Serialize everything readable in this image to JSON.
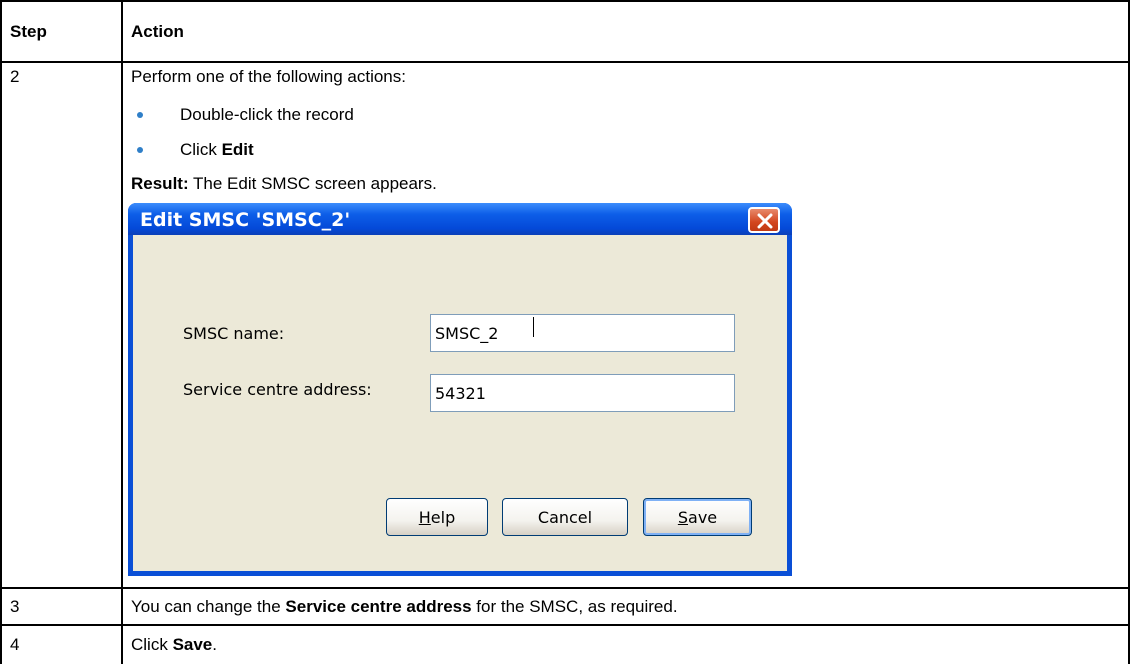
{
  "table": {
    "headers": [
      "Step",
      "Action"
    ],
    "rows": [
      {
        "step": "2",
        "intro": "Perform one of the following actions:",
        "bullets": [
          {
            "text": "Double-click the record",
            "bold": ""
          },
          {
            "text": "Click ",
            "bold": "Edit"
          }
        ],
        "result_label": "Result:",
        "result_text": " The Edit SMSC screen appears."
      },
      {
        "step": "3",
        "pre": "You can change the ",
        "bold": "Service centre address",
        "post": " for the SMSC, as required."
      },
      {
        "step": "4",
        "pre": "Click ",
        "bold": "Save",
        "post": "."
      }
    ]
  },
  "dialog": {
    "title": "Edit SMSC 'SMSC_2'",
    "fields": [
      {
        "label": "SMSC name:",
        "value": "SMSC_2"
      },
      {
        "label": "Service centre address:",
        "value": "54321"
      }
    ],
    "buttons": [
      {
        "label": "Help",
        "mnemonic": "H",
        "rest": "elp"
      },
      {
        "label": "Cancel"
      },
      {
        "label": "Save",
        "mnemonic": "S",
        "rest": "ave"
      }
    ]
  },
  "colors": {
    "bullet": "#2f7fc8",
    "titlebar": "#0449d8",
    "dialog_face": "#ece9d8",
    "close_button": "#d3461e"
  }
}
